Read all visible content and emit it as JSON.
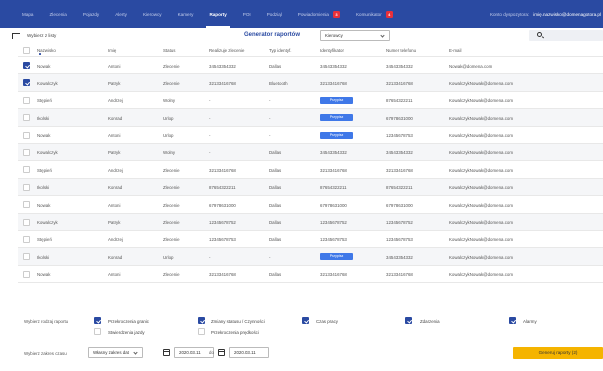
{
  "nav": {
    "tabs": [
      {
        "label": "Mapa"
      },
      {
        "label": "Zlecenia"
      },
      {
        "label": "Pojazdy"
      },
      {
        "label": "Alerty"
      },
      {
        "label": "Kierowcy"
      },
      {
        "label": "Kamery"
      },
      {
        "label": "Raporty",
        "active": true
      },
      {
        "label": "POI"
      },
      {
        "label": "Podziąl"
      },
      {
        "label": "Powiadomienia",
        "badge": "3"
      },
      {
        "label": "Komunikator",
        "badge": "4"
      }
    ],
    "dispatcher_label": "Konto dyspozytora:",
    "dispatcher_email": "imię.nazwisko@domenagotora.pl"
  },
  "toolbar": {
    "back_label": "Wybierz z listy",
    "title": "Generator raportów",
    "select_value": "Kierowcy"
  },
  "table": {
    "headers": [
      "Nazwisko",
      "Imię",
      "Status",
      "Realizuje zlecenie",
      "Typ identyf.",
      "Identyfikator",
      "Numer telefonu",
      "E-mail"
    ],
    "rows": [
      {
        "checked": true,
        "surname": "Nowak",
        "name": "Antoni",
        "status": "Zlecenie",
        "order": "34543354332",
        "idtype": "Dallas",
        "identifier": "34543354332",
        "pill": false,
        "phone": "34543354332",
        "email": "Nowak@domena.com"
      },
      {
        "checked": true,
        "surname": "Kowalczyk",
        "name": "Patryk",
        "status": "Zlecenie",
        "order": "32133416768",
        "idtype": "Bluetooth",
        "identifier": "32133416768",
        "pill": false,
        "phone": "32133416768",
        "email": "KowalczykNowak@domena.com"
      },
      {
        "checked": false,
        "surname": "Stępień",
        "name": "Andrzej",
        "status": "Wolny",
        "order": "-",
        "idtype": "-",
        "identifier": "Przypisz",
        "pill": true,
        "phone": "87654322211",
        "email": "KowalczykNowak@domena.com"
      },
      {
        "checked": false,
        "surname": "Ikolski",
        "name": "Konrad",
        "status": "Urlop",
        "order": "-",
        "idtype": "-",
        "identifier": "Przypisz",
        "pill": true,
        "phone": "67978631000",
        "email": "KowalczykNowak@domena.com"
      },
      {
        "checked": false,
        "surname": "Nowak",
        "name": "Antoni",
        "status": "Urlop",
        "order": "-",
        "idtype": "-",
        "identifier": "Przypisz",
        "pill": true,
        "phone": "12345678753",
        "email": "KowalczykNowak@domena.com"
      },
      {
        "checked": false,
        "surname": "Kowalczyk",
        "name": "Patryk",
        "status": "Wolny",
        "order": "-",
        "idtype": "Dallas",
        "identifier": "34543354332",
        "pill": false,
        "phone": "34543354332",
        "email": "KowalczykNowak@domena.com"
      },
      {
        "checked": false,
        "surname": "Stępień",
        "name": "Andrzej",
        "status": "Zlecenie",
        "order": "32133416768",
        "idtype": "Dallas",
        "identifier": "32133416768",
        "pill": false,
        "phone": "32133416768",
        "email": "KowalczykNowak@domena.com"
      },
      {
        "checked": false,
        "surname": "Ikolski",
        "name": "Konrad",
        "status": "Zlecenie",
        "order": "87654322211",
        "idtype": "Dallas",
        "identifier": "87654322211",
        "pill": false,
        "phone": "87654322211",
        "email": "KowalczykNowak@domena.com"
      },
      {
        "checked": false,
        "surname": "Nowak",
        "name": "Antoni",
        "status": "Zlecenie",
        "order": "67978631000",
        "idtype": "Dallas",
        "identifier": "67978631000",
        "pill": false,
        "phone": "67978631000",
        "email": "KowalczykNowak@domena.com"
      },
      {
        "checked": false,
        "surname": "Kowalczyk",
        "name": "Patryk",
        "status": "Zlecenie",
        "order": "12345678752",
        "idtype": "Dallas",
        "identifier": "12345678752",
        "pill": false,
        "phone": "12345678752",
        "email": "KowalczykNowak@domena.com"
      },
      {
        "checked": false,
        "surname": "Stępień",
        "name": "Andrzej",
        "status": "Zlecenie",
        "order": "12345678753",
        "idtype": "Dallas",
        "identifier": "12345678753",
        "pill": false,
        "phone": "12345678753",
        "email": "KowalczykNowak@domena.com"
      },
      {
        "checked": false,
        "surname": "Ikolski",
        "name": "Konrad",
        "status": "Urlop",
        "order": "-",
        "idtype": "-",
        "identifier": "Przypisz",
        "pill": true,
        "phone": "34543354332",
        "email": "KowalczykNowak@domena.com"
      },
      {
        "checked": false,
        "surname": "Nowak",
        "name": "Antoni",
        "status": "Zlecenie",
        "order": "32133416768",
        "idtype": "Dallas",
        "identifier": "32133416768",
        "pill": false,
        "phone": "32133416768",
        "email": "KowalczykNowak@domena.com"
      }
    ]
  },
  "report_form": {
    "type_label": "Wybierz rodzaj raportu",
    "options": [
      {
        "label": "Przekroczenia granic",
        "checked": true
      },
      {
        "label": "Zmiany statusu / Czynności",
        "checked": true
      },
      {
        "label": "Czas pracy",
        "checked": true
      },
      {
        "label": "Zdarzenia",
        "checked": true
      },
      {
        "label": "Alarmy",
        "checked": true
      },
      {
        "label": "Stwierdzenia jazdy",
        "checked": false
      },
      {
        "label": "Przekroczenia prędkości",
        "checked": false
      }
    ],
    "time_label": "Wybierz zakres czasu",
    "range_value": "Własny zakres dat",
    "date_from": "2020.03.11",
    "date_sep": "do",
    "date_to": "2020.03.11",
    "generate_label": "Generuj raporty (2)"
  },
  "colors": {
    "nav_bg": "#2a4aa2",
    "accent": "#2a4aa2",
    "pill": "#3f78e8",
    "badge": "#e8303a",
    "generate_btn": "#f5b400"
  }
}
